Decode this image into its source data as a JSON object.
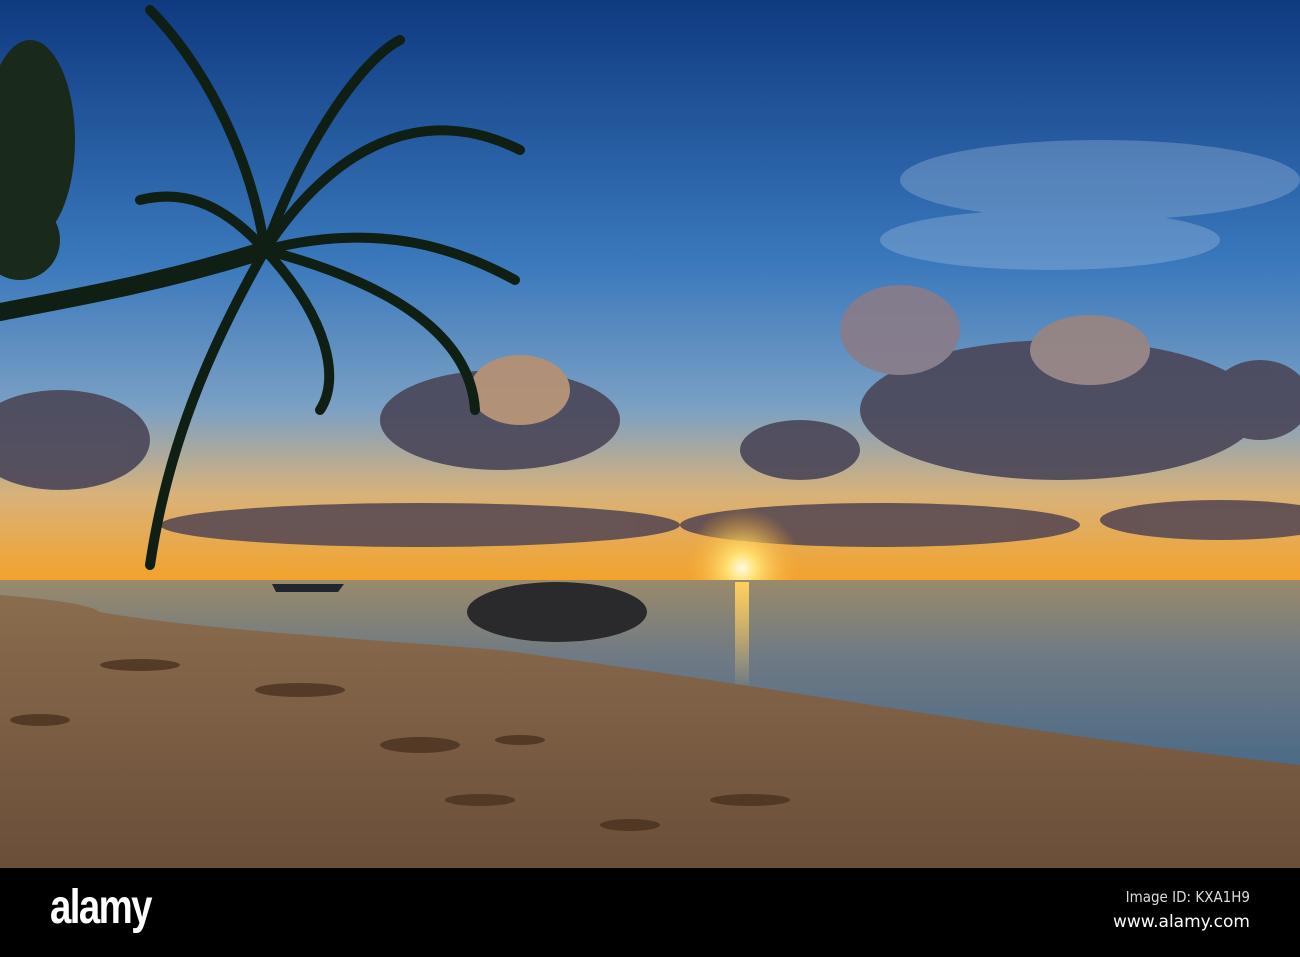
{
  "watermark": {
    "logo": "alamy",
    "image_id": "Image ID: KXA1H9",
    "website": "www.alamy.com"
  },
  "colors": {
    "sky_top": "#123f86",
    "sky_mid": "#3c7cc0",
    "horizon": "#f4a22a",
    "sun": "#fff2b0",
    "sea": "#5d6e80",
    "sand": "#7a5e45",
    "palm": "#0f1f14"
  }
}
